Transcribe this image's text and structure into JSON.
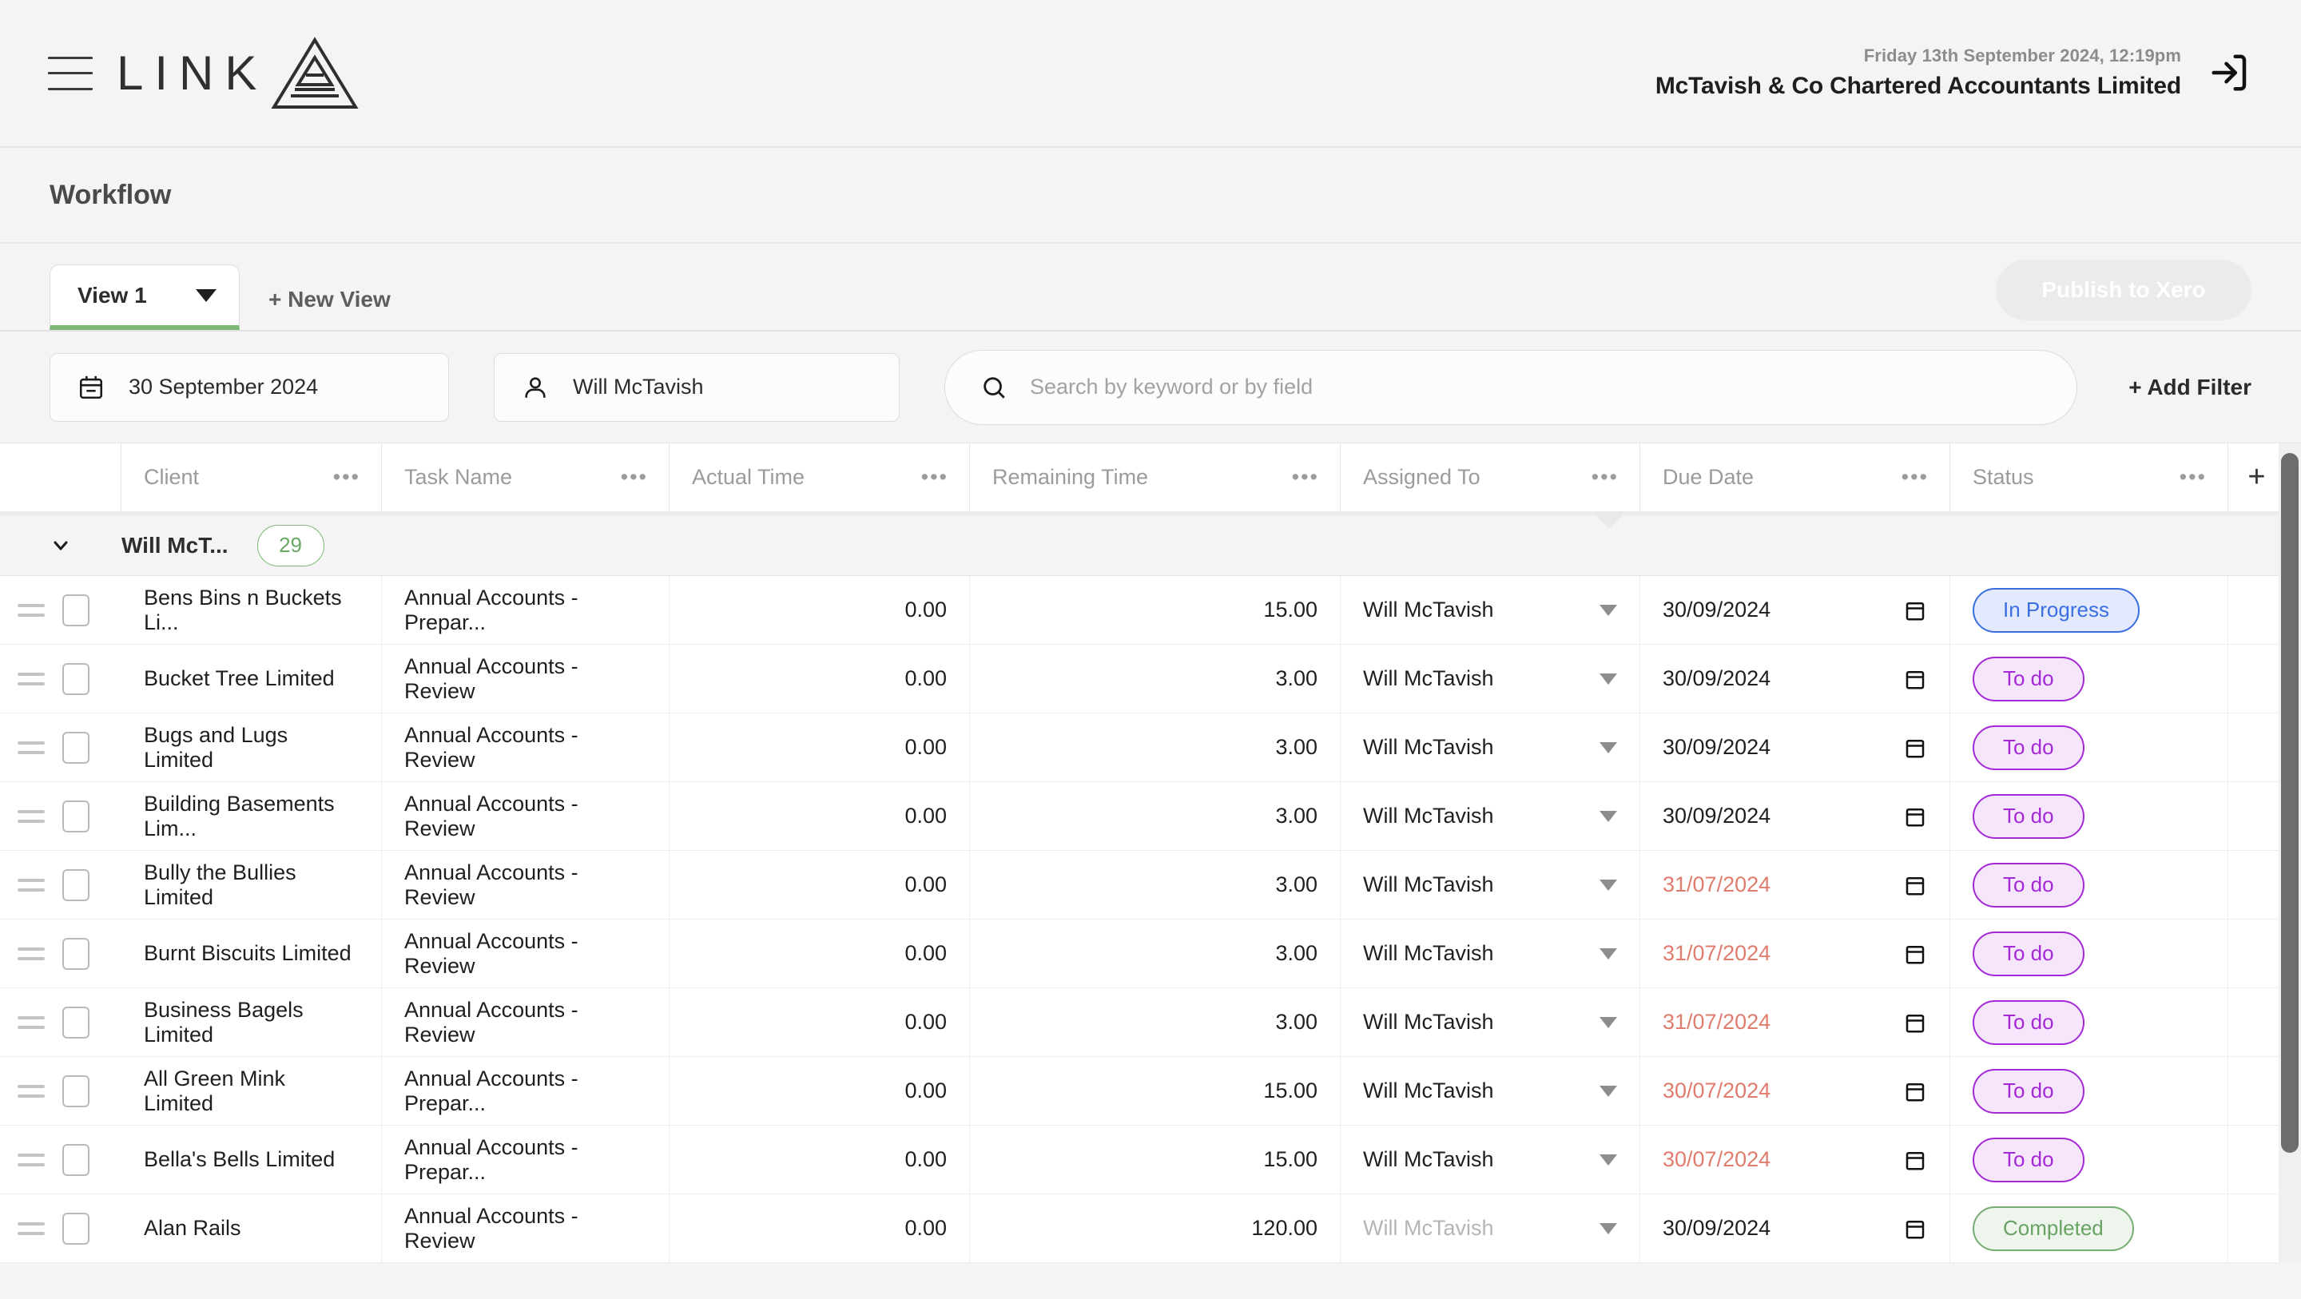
{
  "header": {
    "logo_text": "LINK",
    "logo_mark_icon": "triangle-pyramid-icon",
    "menu_icon": "hamburger-menu-icon",
    "date": "Friday 13th September 2024, 12:19pm",
    "org": "McTavish & Co Chartered Accountants Limited",
    "logout_icon": "logout-icon"
  },
  "page": {
    "title": "Workflow"
  },
  "views": {
    "active_tab": "View 1",
    "new_view_label": "+ New View",
    "publish_label": "Publish to Xero",
    "accent_green": "#7db877"
  },
  "filters": {
    "date": {
      "icon": "calendar-icon",
      "value": "30 September 2024"
    },
    "person": {
      "icon": "user-icon",
      "value": "Will McTavish"
    },
    "search": {
      "icon": "search-icon",
      "value": "",
      "placeholder": "Search by keyword or by field"
    },
    "add_filter_label": "+ Add Filter"
  },
  "table": {
    "columns": [
      {
        "label": "Client",
        "menu": "•••"
      },
      {
        "label": "Task Name",
        "menu": "•••"
      },
      {
        "label": "Actual Time",
        "menu": "•••"
      },
      {
        "label": "Remaining Time",
        "menu": "•••"
      },
      {
        "label": "Assigned To",
        "menu": "•••"
      },
      {
        "label": "Due Date",
        "menu": "•••"
      },
      {
        "label": "Status",
        "menu": "•••"
      }
    ],
    "add_column_label": "+",
    "group": {
      "name": "Will McT...",
      "count": "29"
    },
    "rows": [
      {
        "client": "Bens Bins n Buckets Li...",
        "task": "Annual Accounts - Prepar...",
        "actual": "0.00",
        "remaining": "15.00",
        "assigned": "Will McTavish",
        "due": "30/09/2024",
        "due_overdue": false,
        "status": "In Progress",
        "status_kind": "inprogress",
        "dimmed": false
      },
      {
        "client": "Bucket Tree Limited",
        "task": "Annual Accounts - Review",
        "actual": "0.00",
        "remaining": "3.00",
        "assigned": "Will McTavish",
        "due": "30/09/2024",
        "due_overdue": false,
        "status": "To do",
        "status_kind": "todo",
        "dimmed": false
      },
      {
        "client": "Bugs and Lugs Limited",
        "task": "Annual Accounts - Review",
        "actual": "0.00",
        "remaining": "3.00",
        "assigned": "Will McTavish",
        "due": "30/09/2024",
        "due_overdue": false,
        "status": "To do",
        "status_kind": "todo",
        "dimmed": false
      },
      {
        "client": "Building Basements Lim...",
        "task": "Annual Accounts - Review",
        "actual": "0.00",
        "remaining": "3.00",
        "assigned": "Will McTavish",
        "due": "30/09/2024",
        "due_overdue": false,
        "status": "To do",
        "status_kind": "todo",
        "dimmed": false
      },
      {
        "client": "Bully the Bullies Limited",
        "task": "Annual Accounts - Review",
        "actual": "0.00",
        "remaining": "3.00",
        "assigned": "Will McTavish",
        "due": "31/07/2024",
        "due_overdue": true,
        "status": "To do",
        "status_kind": "todo",
        "dimmed": false
      },
      {
        "client": "Burnt Biscuits Limited",
        "task": "Annual Accounts - Review",
        "actual": "0.00",
        "remaining": "3.00",
        "assigned": "Will McTavish",
        "due": "31/07/2024",
        "due_overdue": true,
        "status": "To do",
        "status_kind": "todo",
        "dimmed": false
      },
      {
        "client": "Business Bagels Limited",
        "task": "Annual Accounts - Review",
        "actual": "0.00",
        "remaining": "3.00",
        "assigned": "Will McTavish",
        "due": "31/07/2024",
        "due_overdue": true,
        "status": "To do",
        "status_kind": "todo",
        "dimmed": false
      },
      {
        "client": "All Green Mink Limited",
        "task": "Annual Accounts - Prepar...",
        "actual": "0.00",
        "remaining": "15.00",
        "assigned": "Will McTavish",
        "due": "30/07/2024",
        "due_overdue": true,
        "status": "To do",
        "status_kind": "todo",
        "dimmed": false
      },
      {
        "client": "Bella's Bells Limited",
        "task": "Annual Accounts - Prepar...",
        "actual": "0.00",
        "remaining": "15.00",
        "assigned": "Will McTavish",
        "due": "30/07/2024",
        "due_overdue": true,
        "status": "To do",
        "status_kind": "todo",
        "dimmed": false
      },
      {
        "client": "Alan Rails",
        "task": "Annual Accounts - Review",
        "actual": "0.00",
        "remaining": "120.00",
        "assigned": "Will McTavish",
        "due": "30/09/2024",
        "due_overdue": false,
        "status": "Completed",
        "status_kind": "completed",
        "dimmed": true
      }
    ]
  },
  "colors": {
    "accent_green": "#7db877",
    "overdue_red": "#e07c6d",
    "status_inprogress": "#3b6fe0",
    "status_todo": "#a429d6",
    "status_completed": "#6aa265"
  }
}
